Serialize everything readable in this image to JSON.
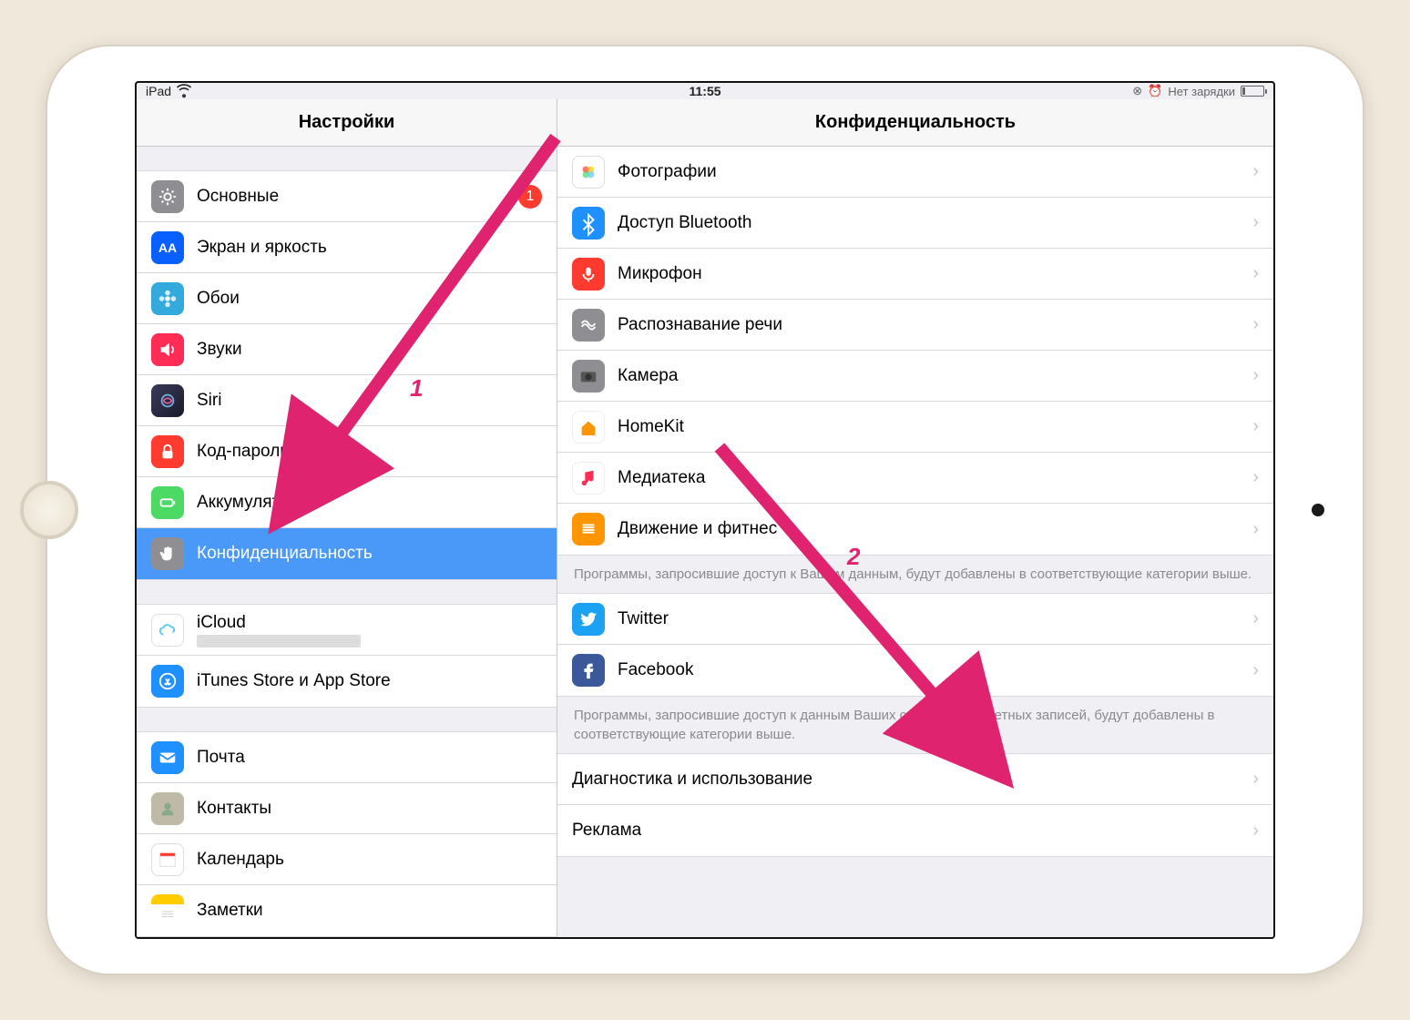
{
  "statusbar": {
    "device": "iPad",
    "time": "11:55",
    "battery_text": "Нет зарядки"
  },
  "sidebar": {
    "title": "Настройки",
    "group1": [
      {
        "key": "general",
        "label": "Основные",
        "icon_bg": "#8e8e93",
        "icon": "gear",
        "badge": "1"
      },
      {
        "key": "display",
        "label": "Экран и яркость",
        "icon_bg": "#0a60ff",
        "icon": "AA"
      },
      {
        "key": "wallpaper",
        "label": "Обои",
        "icon_bg": "#34aadc",
        "icon": "flower"
      },
      {
        "key": "sounds",
        "label": "Звуки",
        "icon_bg": "#ff2d55",
        "icon": "speaker"
      },
      {
        "key": "siri",
        "label": "Siri",
        "icon_bg": "#1c1c1e",
        "icon": "siri"
      },
      {
        "key": "passcode",
        "label": "Код-пароль",
        "icon_bg": "#ff3b30",
        "icon": "lock"
      },
      {
        "key": "battery",
        "label": "Аккумулятор",
        "icon_bg": "#4cd964",
        "icon": "battery"
      },
      {
        "key": "privacy",
        "label": "Конфиденциальность",
        "icon_bg": "#8e8e93",
        "icon": "hand",
        "selected": true
      }
    ],
    "group2": [
      {
        "key": "icloud",
        "label": "iCloud",
        "icon_bg": "#ffffff",
        "icon": "cloud",
        "sub": true
      },
      {
        "key": "appstore",
        "label": "iTunes Store и App Store",
        "icon_bg": "#1e90ff",
        "icon": "appstore"
      }
    ],
    "group3": [
      {
        "key": "mail",
        "label": "Почта",
        "icon_bg": "#1e90ff",
        "icon": "mail"
      },
      {
        "key": "contacts",
        "label": "Контакты",
        "icon_bg": "#d9d5c6",
        "icon": "contacts"
      },
      {
        "key": "calendar",
        "label": "Календарь",
        "icon_bg": "#ffffff",
        "icon": "calendar"
      },
      {
        "key": "notes",
        "label": "Заметки",
        "icon_bg": "#ffcc00",
        "icon": "notes"
      }
    ]
  },
  "detail": {
    "title": "Конфиденциальность",
    "groupA": [
      {
        "label": "Фотографии",
        "icon_bg": "#ffffff",
        "icon": "photos"
      },
      {
        "label": "Доступ Bluetooth",
        "icon_bg": "#1e90ff",
        "icon": "bluetooth"
      },
      {
        "label": "Микрофон",
        "icon_bg": "#ff3b30",
        "icon": "mic"
      },
      {
        "label": "Распознавание речи",
        "icon_bg": "#8e8e93",
        "icon": "speech"
      },
      {
        "label": "Камера",
        "icon_bg": "#8e8e93",
        "icon": "camera"
      },
      {
        "label": "HomeKit",
        "icon_bg": "#ffffff",
        "icon": "home"
      },
      {
        "label": "Медиатека",
        "icon_bg": "#ffffff",
        "icon": "music"
      },
      {
        "label": "Движение и фитнес",
        "icon_bg": "#ff9500",
        "icon": "fitness"
      }
    ],
    "footerA": "Программы, запросившие доступ к Вашим данным, будут добавлены в соответствующие категории выше.",
    "groupB": [
      {
        "label": "Twitter",
        "icon_bg": "#1da1f2",
        "icon": "twitter"
      },
      {
        "label": "Facebook",
        "icon_bg": "#3b5998",
        "icon": "facebook"
      }
    ],
    "footerB": "Программы, запросившие доступ к данным Ваших социальных учетных записей, будут добавлены в соответствующие категории выше.",
    "groupC": [
      {
        "label": "Диагностика и использование"
      },
      {
        "label": "Реклама"
      }
    ]
  },
  "annotations": {
    "num1": "1",
    "num2": "2"
  }
}
